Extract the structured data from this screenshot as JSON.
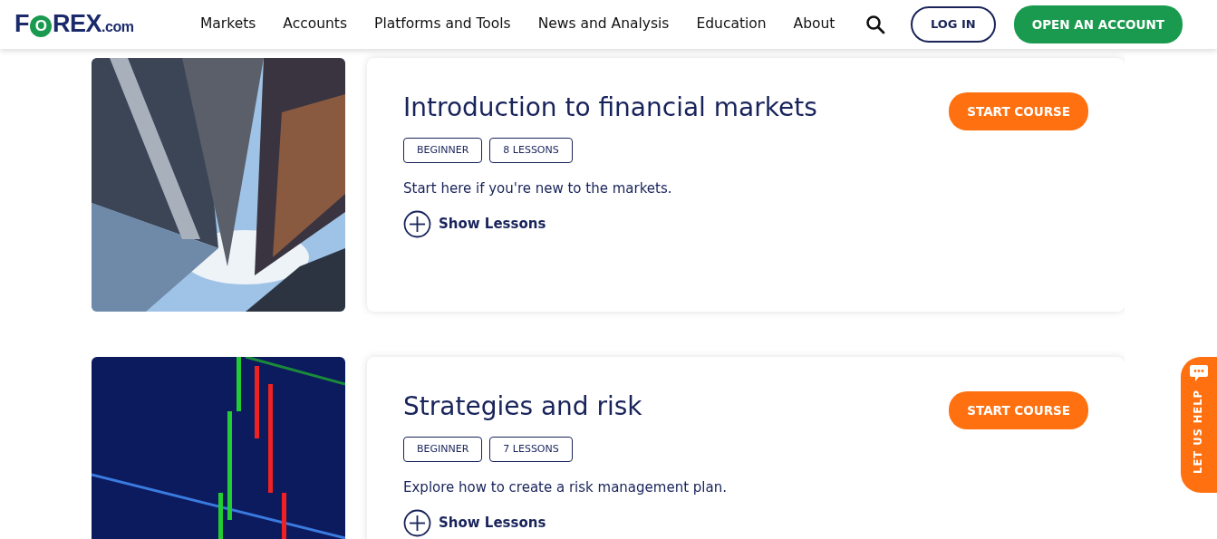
{
  "header": {
    "logo": {
      "parts": [
        "F",
        "O",
        "REX"
      ],
      "suffix": ".com"
    },
    "nav": [
      "Markets",
      "Accounts",
      "Platforms and Tools",
      "News and Analysis",
      "Education",
      "About"
    ],
    "login": "LOG IN",
    "open_account": "OPEN AN ACCOUNT"
  },
  "courses": [
    {
      "title": "Introduction to financial markets",
      "tags": [
        "BEGINNER",
        "8 LESSONS"
      ],
      "description": "Start here if you're new to the markets.",
      "toggle": "Show Lessons",
      "button": "START COURSE"
    },
    {
      "title": "Strategies and risk",
      "tags": [
        "BEGINNER",
        "7 LESSONS"
      ],
      "description": "Explore how to create a risk management plan.",
      "toggle": "Show Lessons",
      "button": "START COURSE"
    }
  ],
  "help_tab": "LET US HELP"
}
